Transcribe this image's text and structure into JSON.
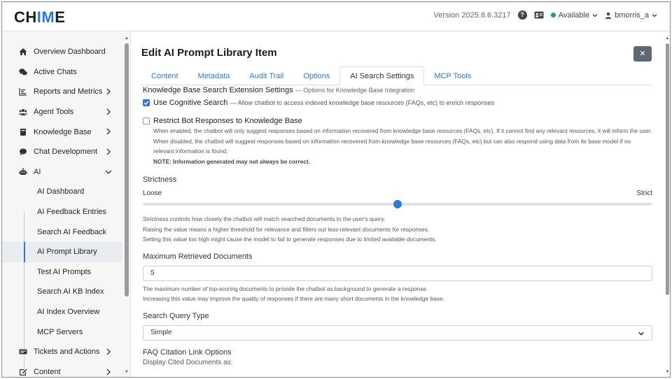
{
  "header": {
    "logo_left": "CH",
    "logo_mid": "IM",
    "logo_right": "E",
    "version": "Version 2025.8.6.3217",
    "help_glyph": "?",
    "status": "Available",
    "user": "bmorris_a"
  },
  "colors": {
    "accent": "#2f78d1",
    "status_green": "#1aa55a",
    "close_bg": "#5f6770"
  },
  "sidebar": {
    "items": [
      {
        "label": "Overview Dashboard",
        "icon": "home-icon"
      },
      {
        "label": "Active Chats",
        "icon": "chat-bubbles-icon"
      },
      {
        "label": "Reports and Metrics",
        "icon": "report-chart-icon"
      },
      {
        "label": "Agent Tools",
        "icon": "agents-icon"
      },
      {
        "label": "Knowledge Base",
        "icon": "book-icon"
      },
      {
        "label": "Chat Development",
        "icon": "chat-dev-icon"
      },
      {
        "label": "AI",
        "icon": "robot-icon"
      }
    ],
    "ai_sub": [
      "AI Dashboard",
      "AI Feedback Entries",
      "Search AI Feedback",
      "AI Prompt Library",
      "Test AI Prompts",
      "Search AI KB Index",
      "AI Index Overview",
      "MCP Servers"
    ],
    "bottom_items": [
      {
        "label": "Tickets and Actions",
        "icon": "tickets-icon"
      },
      {
        "label": "Content",
        "icon": "content-edit-icon"
      }
    ]
  },
  "main": {
    "title": "Edit AI Prompt Library Item",
    "close_glyph": "✕",
    "tabs": [
      "Content",
      "Metadata",
      "Audit Trail",
      "Options",
      "AI Search Settings",
      "MCP Tools"
    ],
    "kb": {
      "title": "Knowledge Base Search Extension Settings",
      "subtitle": "— Options for Knowledge Base Integration",
      "cognitive_label": "Use Cognitive Search",
      "cognitive_sub": "— Allow chatbot to access indexed knowledge base resources (FAQs, etc) to enrich responses",
      "restrict_label": "Restrict Bot Responses to Knowledge Base",
      "restrict_desc1": "When enabled, the chatbot will only suggest responses based on information recovered from knowledge base resources (FAQs, etc). If it cannot find any relevant resources, it will inform the user.",
      "restrict_desc2": "When disabled, the chatbot will suggest responses based on information recovered from knowledge base resources (FAQs, etc) but can also respond using data from its base model if no relevant information is found.",
      "restrict_note": "NOTE: Information generated may not always be correct."
    },
    "strictness": {
      "label": "Strictness",
      "min_label": "Loose",
      "max_label": "Strict",
      "level": 0.5,
      "help1": "Strictness controls how closely the chatbot will match searched documents to the user's query.",
      "help2": "Raising the value means a higher threshold for relevance and filters out less-relevant documents for responses.",
      "help3": "Setting this value too high might cause the model to fail to generate responses due to limited available documents."
    },
    "max_docs": {
      "label": "Maximum Retrieved Documents",
      "value": "5",
      "help1": "The maximum number of top-scoring documents to provide the chatbot as background to generate a response.",
      "help2": "Increasing this value may improve the quality of responses if there are many short documents in the knowledge base."
    },
    "query_type": {
      "label": "Search Query Type",
      "value": "Simple"
    },
    "faq": {
      "label": "FAQ Citation Link Options",
      "display_label": "Display Cited Documents as:"
    }
  }
}
